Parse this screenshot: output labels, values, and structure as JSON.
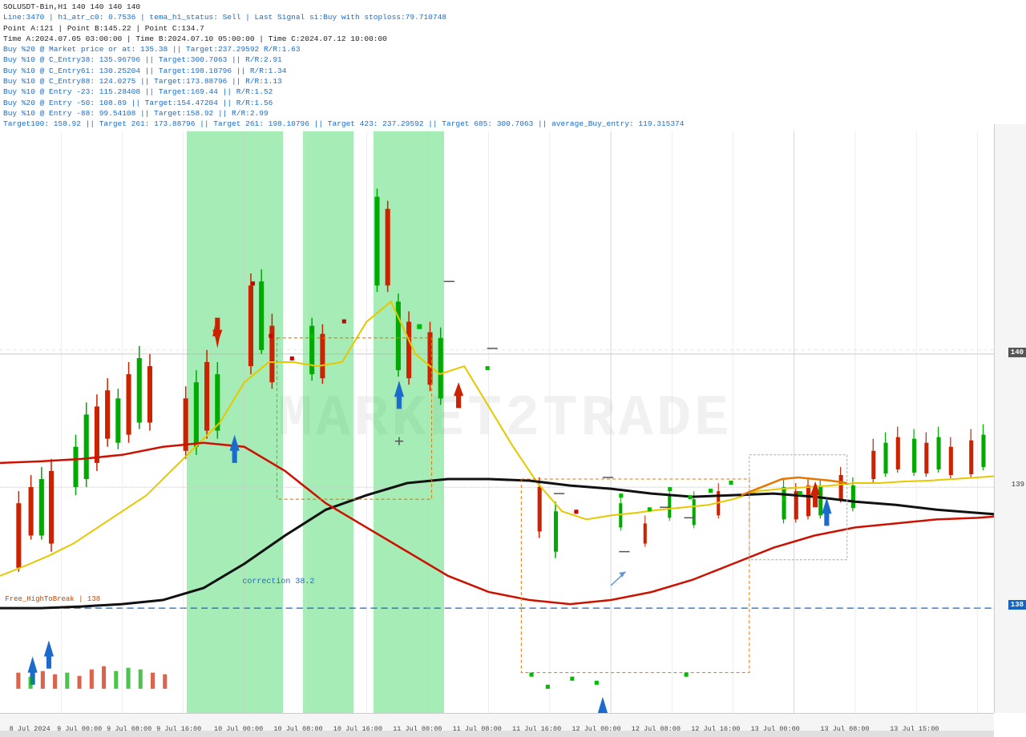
{
  "header": {
    "title": "SOLUSDT-Bin,H1  140  140  140  140",
    "line1": "Line:3470  |  h1_atr_c0: 0.7536  |  tema_h1_status: Sell  |  Last Signal  si:Buy with stoploss:79.710748",
    "line2": "Point A:121  |  Point B:145.22  |  Point C:134.7",
    "line3": "Time A:2024.07.05 03:00:00  |  Time B:2024.07.10 05:00:00  |  Time C:2024.07.12 10:00:00",
    "line4": "Buy %20 @ Market price or at: 135.38  ||  Target:237.29592  R/R:1.63",
    "line5": "Buy %10 @ C_Entry38: 135.96796  ||  Target:300.7063  ||  R/R:2.91",
    "line6": "Buy %10 @ C_Entry61: 130.25204  ||  Target:198.10796  ||  R/R:1.34",
    "line7": "Buy %10 @ C_Entry88: 124.0275  ||  Target:173.88796  ||  R/R:1.13",
    "line8": "Buy %10 @ Entry -23: 115.28408  ||  Target:169.44  ||  R/R:1.52",
    "line9": "Buy %20 @ Entry -50: 108.89  ||  Target:154.47204  ||  R/R:1.56",
    "line10": "Buy %10 @ Entry -88: 99.54108  ||  Target:158.92  ||  R/R:2.99",
    "line11": "Target100: 158.92  ||  Target 261: 173.88796  ||  Target 261: 198.10796  ||  Target 423: 237.29592  ||  Target 685: 300.7063  ||  average_Buy_entry: 119.315374"
  },
  "price_levels": {
    "p140": "140",
    "p139": "139",
    "p138": "138"
  },
  "labels": {
    "correction": "correction 38.2",
    "high_break": "Free_HighToBreak | 138"
  },
  "watermark": "MARKET2TRADE",
  "time_labels": [
    "8 Jul 2024",
    "9 Jul 00:00",
    "9 Jul 08:00",
    "9 Jul 16:00",
    "10 Jul 00:00",
    "10 Jul 08:00",
    "10 Jul 16:00",
    "11 Jul 00:00",
    "11 Jul 08:00",
    "11 Jul 16:00",
    "12 Jul 00:00",
    "12 Jul 08:00",
    "12 Jul 16:00",
    "13 Jul 00:00",
    "13 Jul 08:00",
    "13 Jul 15:00"
  ],
  "colors": {
    "background": "#ffffff",
    "green_zone": "rgba(0,180,50,0.32)",
    "yellow_line": "#e6c800",
    "black_line": "#111111",
    "red_line": "#cc0000",
    "blue_dashed": "#1565C0",
    "price140_line": "#888888",
    "watermark": "rgba(170,170,170,0.15)"
  }
}
